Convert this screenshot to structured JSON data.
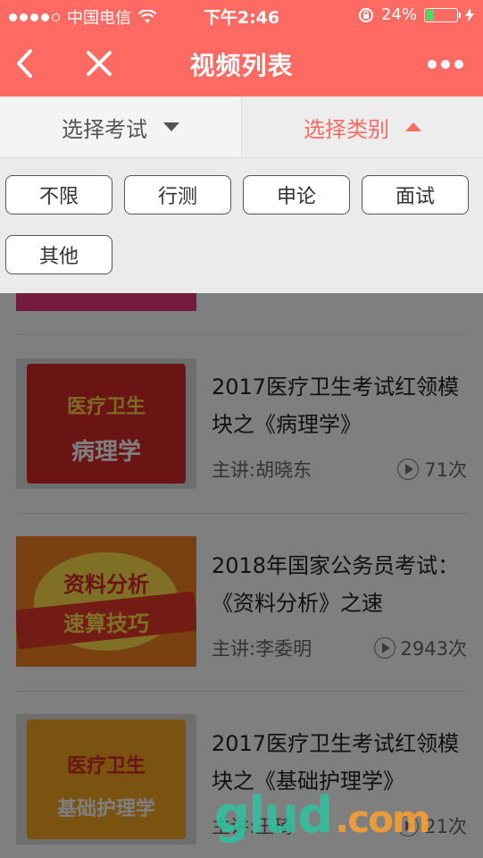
{
  "status_bar": {
    "carrier": "中国电信",
    "time": "下午2:46",
    "battery_percent": "24%",
    "battery_level": 0.24,
    "signal_bars": 4,
    "icons": [
      "signal-dots-icon",
      "wifi-icon",
      "rotation-lock-icon",
      "battery-icon",
      "charging-icon"
    ]
  },
  "nav": {
    "title": "视频列表",
    "back_icon": "chevron-left-icon",
    "close_icon": "close-icon",
    "more_icon": "more-dots-icon"
  },
  "filters": {
    "exam_label": "选择考试",
    "category_label": "选择类别"
  },
  "categories": [
    "不限",
    "行测",
    "申论",
    "面试",
    "其他"
  ],
  "videos": [
    {
      "title": "2017医疗卫生考试红领模块之《病理学》",
      "lecturer": "主讲:胡晓东",
      "views": "71次",
      "thumb_line1": "医疗卫生",
      "thumb_line2": "病理学"
    },
    {
      "title": "2018年国家公务员考试：《资料分析》之速",
      "lecturer": "主讲:李委明",
      "views": "2943次",
      "thumb_line1": "资料分析",
      "thumb_line2": "速算技巧"
    },
    {
      "title": "2017医疗卫生考试红领模块之《基础护理学》",
      "lecturer": "主讲:王琦",
      "views": "21次",
      "thumb_line1": "医疗卫生",
      "thumb_line2": "基础护理学"
    }
  ],
  "watermark": {
    "text": "glud",
    "suffix": ".com"
  },
  "colors": {
    "accent": "#FF6A63",
    "battery_fill": "#4CD964"
  }
}
